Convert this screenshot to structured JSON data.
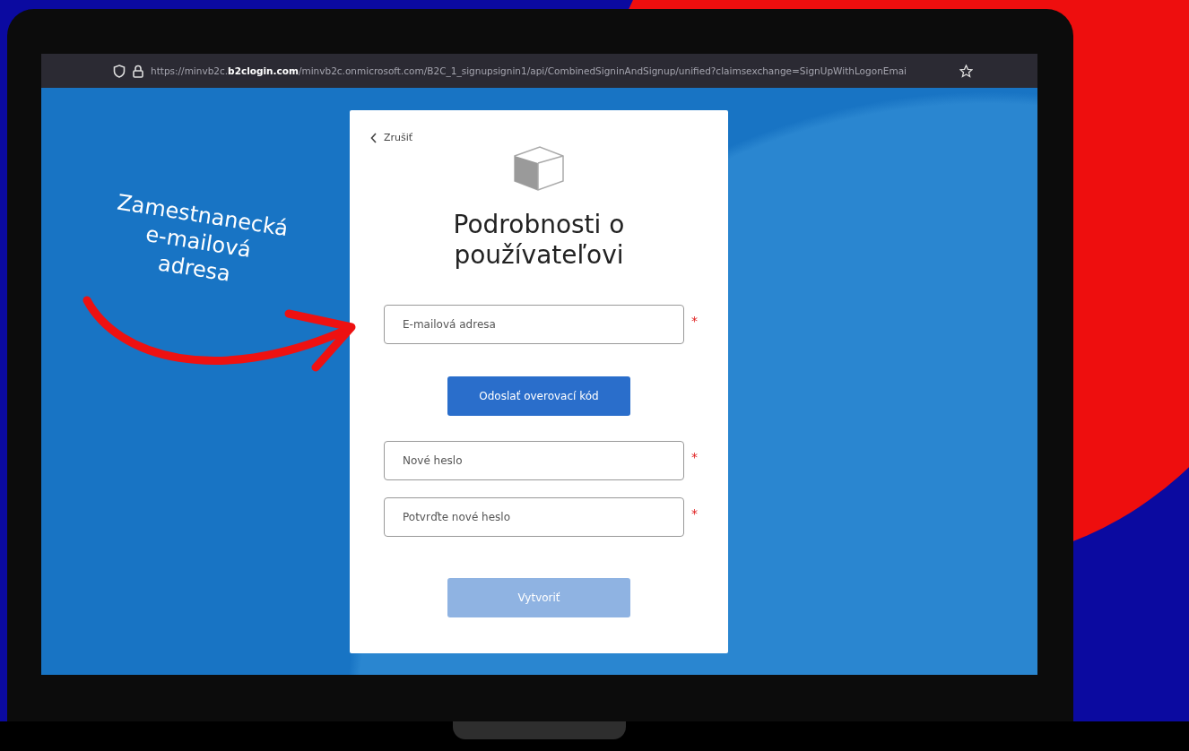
{
  "browser": {
    "url": "https://minvb2c.**b2clogin.com**/minvb2c.onmicrosoft.com/B2C_1_signupsignin1/api/CombinedSigninAndSignup/unified?claimsexchange=SignUpWithLogonEmai"
  },
  "annotation": {
    "lines": [
      "Zamestnanecká",
      "e-mailová",
      "adresa"
    ]
  },
  "form": {
    "cancel": "Zrušiť",
    "title": "Podrobnosti o používateľovi",
    "fields": [
      {
        "placeholder": "E-mailová adresa",
        "required_mark": "*"
      }
    ],
    "send_button": {
      "label": "Odoslať overovací kód",
      "disabled": false
    },
    "password_fields": [
      {
        "placeholder": "Nové heslo",
        "required_mark": "*"
      },
      {
        "placeholder": "Potvrďte nové heslo",
        "required_mark": "*"
      }
    ],
    "create_button": {
      "label": "Vytvoriť",
      "disabled": true
    }
  }
}
